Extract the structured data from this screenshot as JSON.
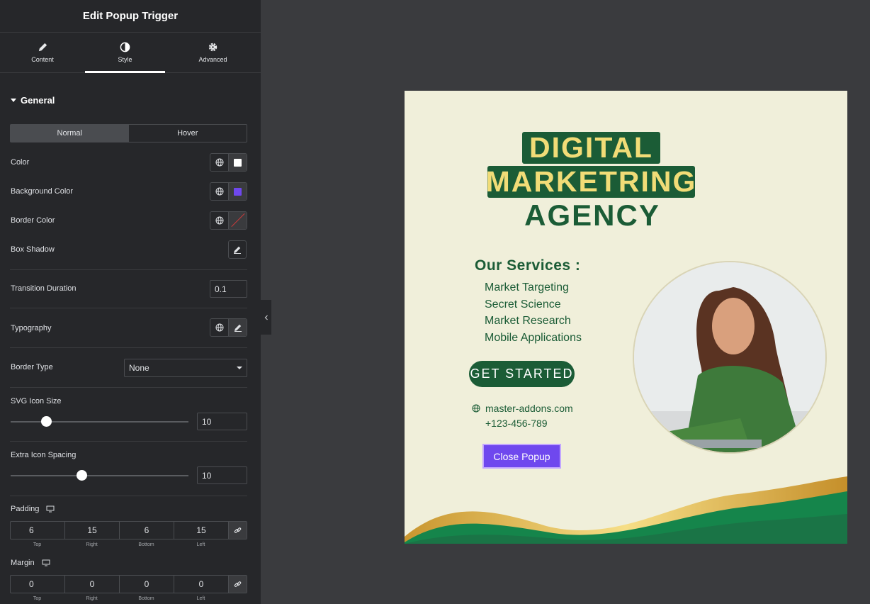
{
  "panel": {
    "title": "Edit Popup Trigger",
    "tabs": [
      {
        "label": "Content",
        "icon": "pencil-icon"
      },
      {
        "label": "Style",
        "icon": "contrast-icon",
        "active": true
      },
      {
        "label": "Advanced",
        "icon": "gear-icon"
      }
    ],
    "section_title": "General",
    "state_toggle": {
      "normal": "Normal",
      "hover": "Hover",
      "selected": "Normal"
    },
    "color_label": "Color",
    "color_value": "#ffffff",
    "bg_color_label": "Background Color",
    "bg_color_value": "#6f48ee",
    "border_color_label": "Border Color",
    "box_shadow_label": "Box Shadow",
    "transition_label": "Transition Duration",
    "transition_value": "0.1",
    "typography_label": "Typography",
    "border_type_label": "Border Type",
    "border_type_value": "None",
    "svg_size_label": "SVG Icon Size",
    "svg_size_value": "10",
    "svg_size_slider_fraction": 0.2,
    "spacing_label": "Extra Icon Spacing",
    "spacing_value": "10",
    "spacing_slider_fraction": 0.4,
    "padding_label": "Padding",
    "padding": {
      "top": "6",
      "right": "15",
      "bottom": "6",
      "left": "15"
    },
    "margin_label": "Margin",
    "margin": {
      "top": "0",
      "right": "0",
      "bottom": "0",
      "left": "0"
    },
    "dim_labels": {
      "top": "Top",
      "right": "Right",
      "bottom": "Bottom",
      "left": "Left"
    }
  },
  "popup": {
    "title_line1": "DIGITAL",
    "title_line2": "MARKETRING",
    "title_line3": "AGENCY",
    "services_title": "Our Services :",
    "services": [
      "Market Targeting",
      "Secret Science",
      "Market Research",
      "Mobile Applications"
    ],
    "cta_label": "GET STARTED",
    "website": "master-addons.com",
    "phone": "+123-456-789",
    "close_label": "Close Popup",
    "colors": {
      "green": "#1b5c36",
      "gold": "#f1dc77",
      "cream": "#f0efda",
      "button": "#6f48ee"
    }
  }
}
